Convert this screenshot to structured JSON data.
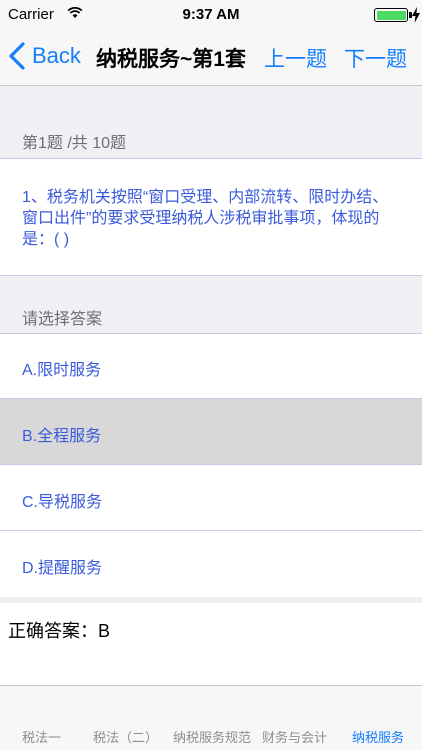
{
  "status_bar": {
    "carrier": "Carrier",
    "time": "9:37 AM",
    "battery_color": "#4cd964"
  },
  "nav": {
    "back_label": "Back",
    "title": "纳税服务~第1套",
    "prev_label": "上一题",
    "next_label": "下一题",
    "accent_color": "#157efb"
  },
  "question": {
    "counter": "第1题 /共 10题",
    "text": "1、税务机关按照“窗口受理、内部流转、限时办结、窗口出件”的要求受理纳税人涉税审批事项，体现的是：(     )"
  },
  "answers": {
    "header": "请选择答案",
    "options": [
      {
        "label": "A.限时服务",
        "selected": false
      },
      {
        "label": "B.全程服务",
        "selected": true
      },
      {
        "label": "C.导税服务",
        "selected": false
      },
      {
        "label": "D.提醒服务",
        "selected": false
      }
    ]
  },
  "result": {
    "text": "正确答案：B"
  },
  "tabs": [
    {
      "label": "税法一",
      "active": false
    },
    {
      "label": "税法（二）",
      "active": false
    },
    {
      "label": "纳税服务规范",
      "active": false
    },
    {
      "label": "财务与会计",
      "active": false
    },
    {
      "label": "纳税服务",
      "active": true
    }
  ]
}
